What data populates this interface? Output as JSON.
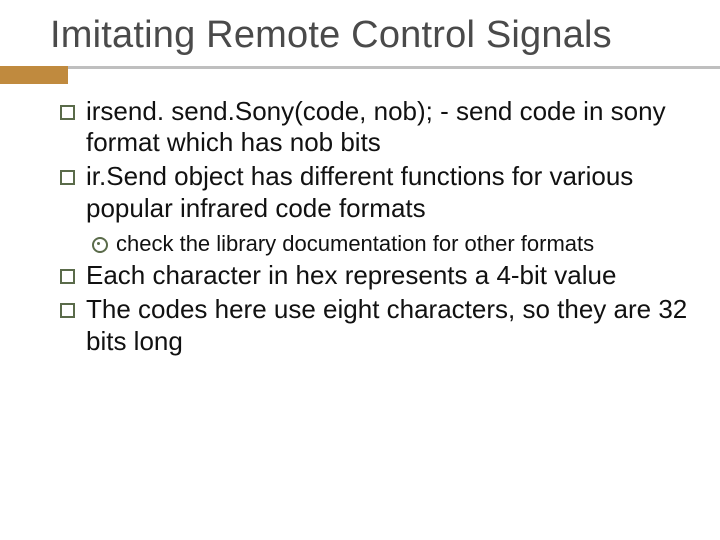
{
  "title": "Imitating Remote Control Signals",
  "bullets": {
    "b1": "irsend. send.Sony(code, nob); - send code in sony format which has nob bits",
    "b2": "ir.Send object has different functions for various popular infrared code formats",
    "b2_sub1": "check the library documentation for other formats",
    "b3": "Each character in hex represents a 4-bit value",
    "b4": "The codes here use eight characters, so they are 32 bits long"
  },
  "colors": {
    "accent": "#c08a3e",
    "rule": "#bfbfbf",
    "bullet_border": "#5a6b4a"
  }
}
